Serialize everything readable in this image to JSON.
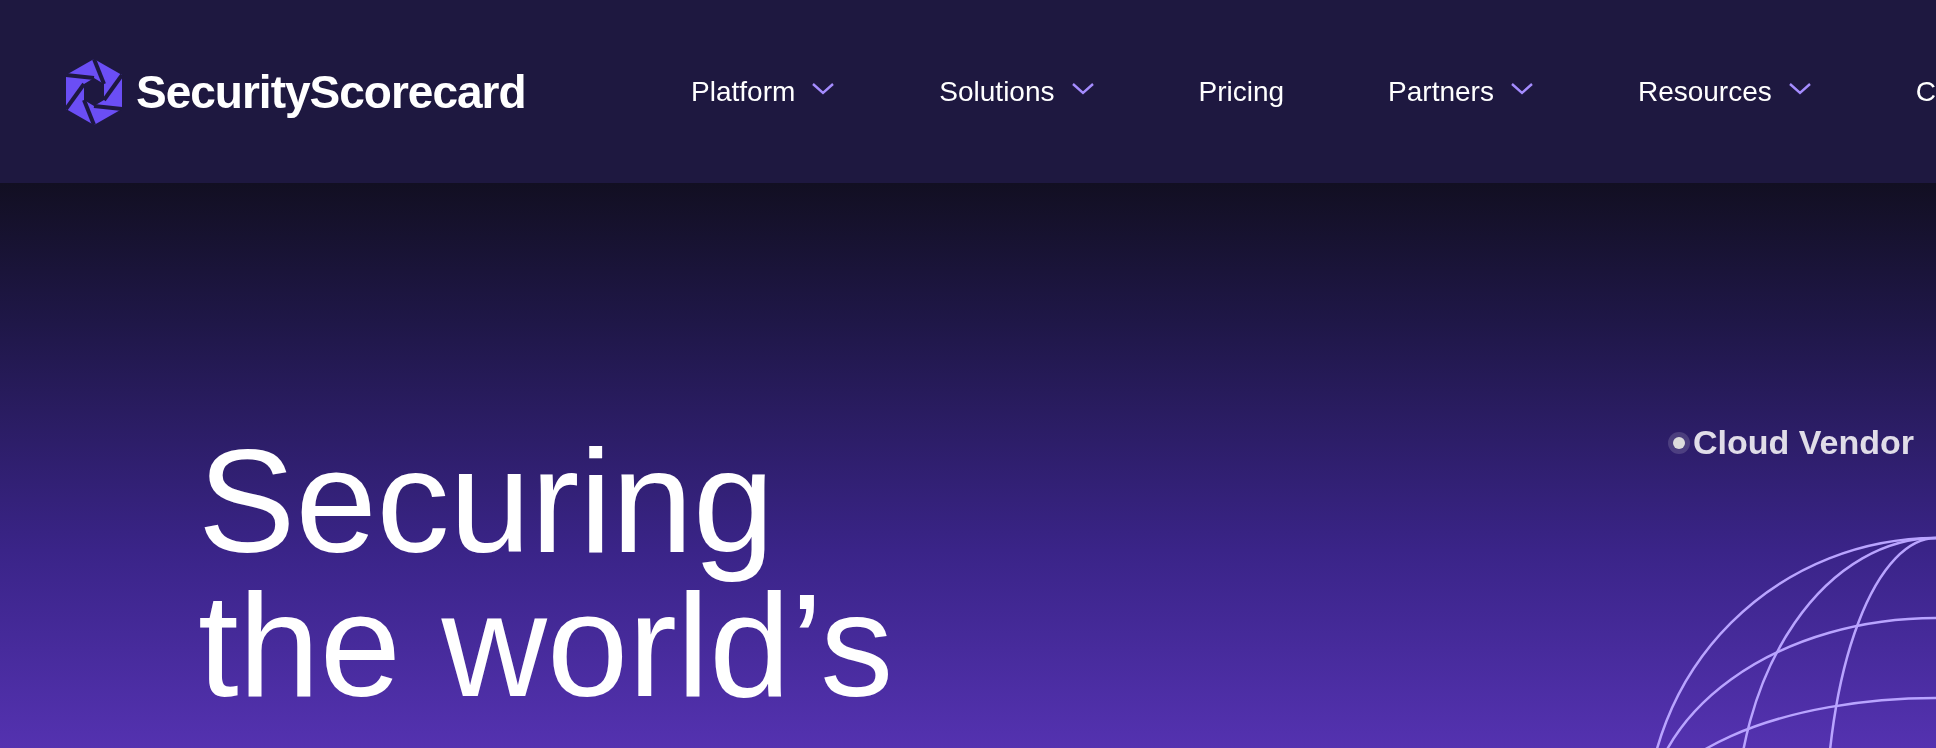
{
  "header": {
    "logo": {
      "text": "SecurityScorecard"
    },
    "nav": [
      {
        "label": "Platform",
        "has_dropdown": true
      },
      {
        "label": "Solutions",
        "has_dropdown": true
      },
      {
        "label": "Pricing",
        "has_dropdown": false
      },
      {
        "label": "Partners",
        "has_dropdown": true
      },
      {
        "label": "Resources",
        "has_dropdown": true
      },
      {
        "label": "C",
        "has_dropdown": false
      }
    ]
  },
  "hero": {
    "headline": [
      "Securing",
      "the world’s"
    ],
    "globe_label": "Cloud Vendor"
  }
}
